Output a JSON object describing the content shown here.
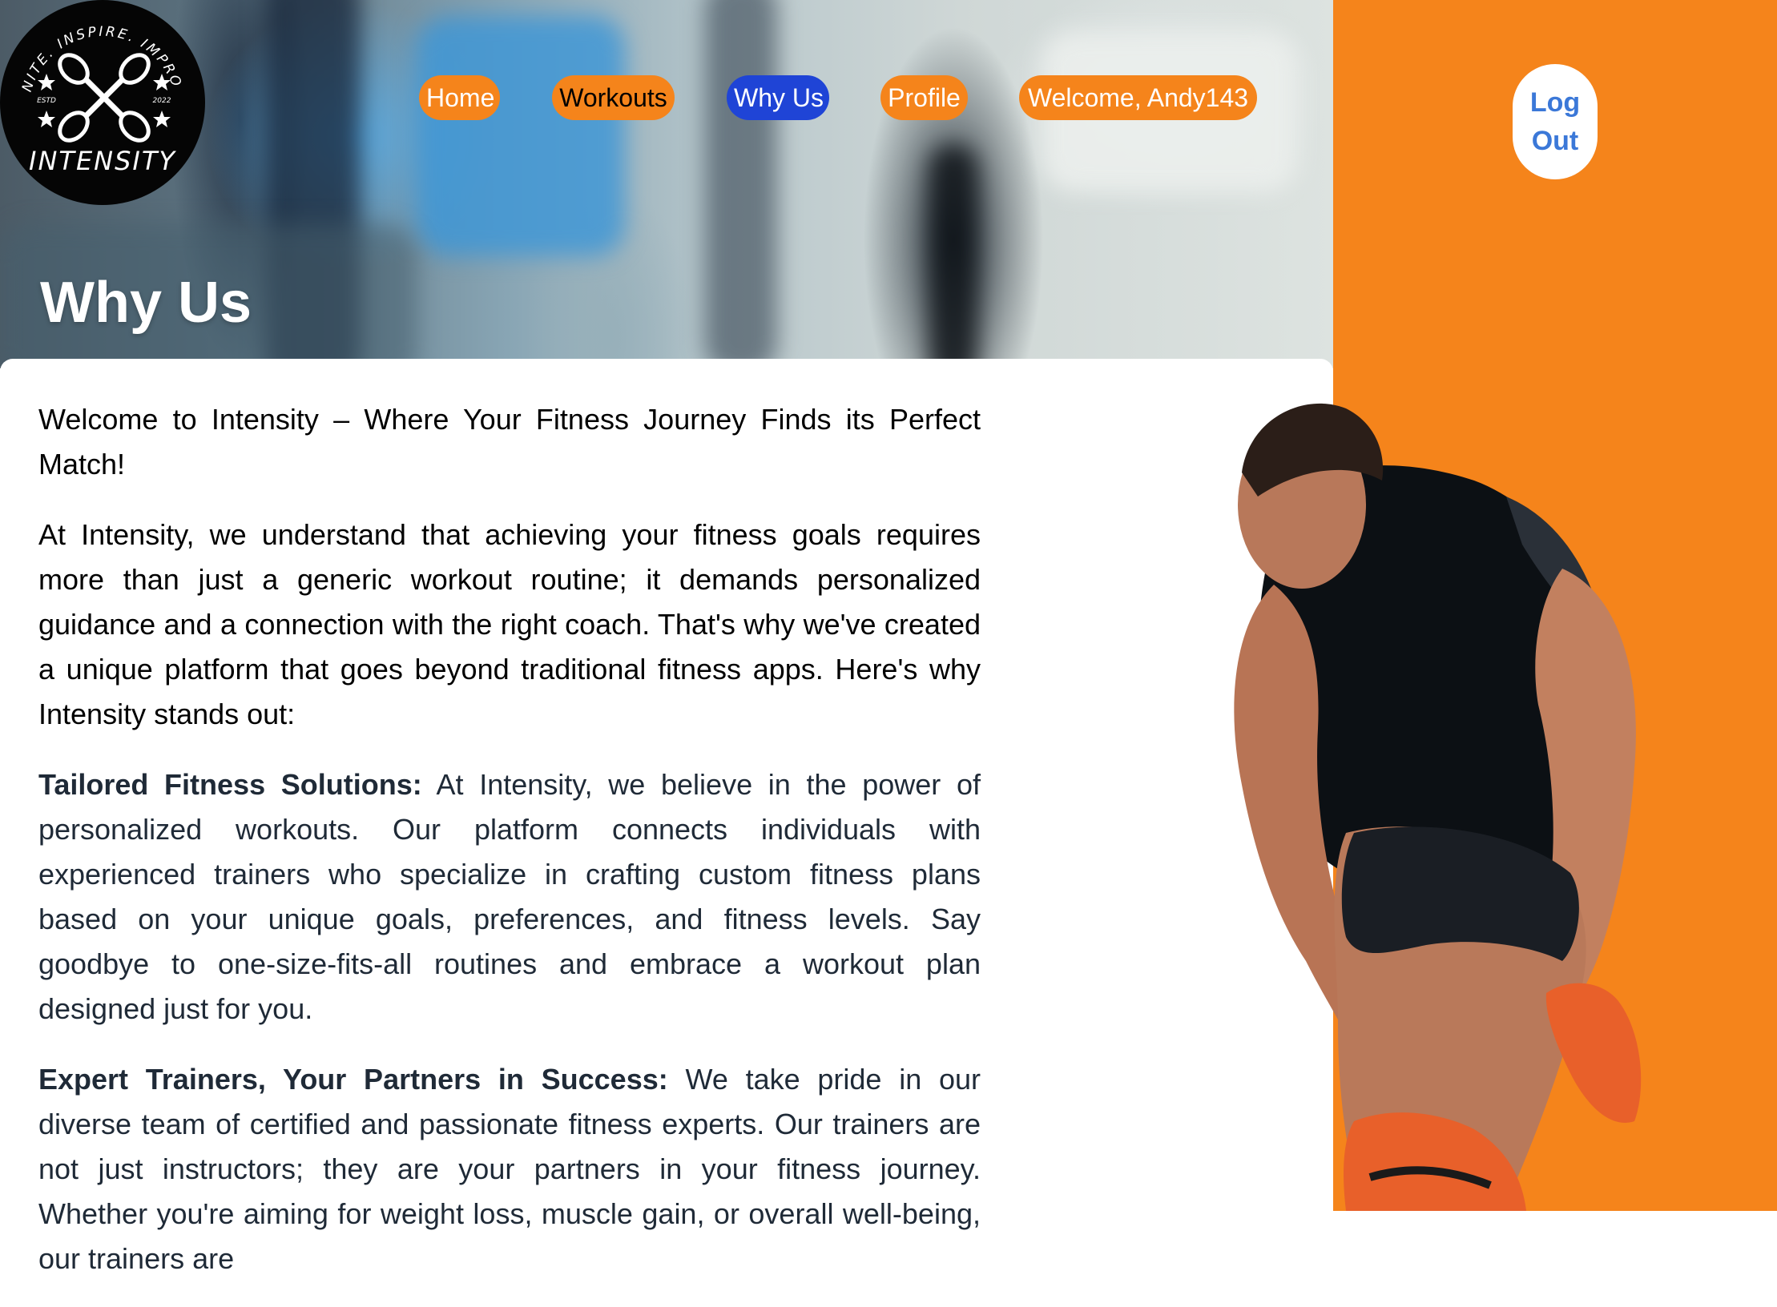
{
  "logo": {
    "name": "INTENSITY",
    "tagline": "IGNITE. INSPIRE. IMPROVE",
    "estd_left": "ESTD",
    "estd_right": "2022"
  },
  "nav": {
    "home": "Home",
    "workouts": "Workouts",
    "why_us": "Why Us",
    "profile": "Profile",
    "welcome": "Welcome, Andy143"
  },
  "logout": {
    "line1": "Log",
    "line2": "Out"
  },
  "page_title": "Why Us",
  "content": {
    "intro": "Welcome to Intensity – Where Your Fitness Journey Finds its Perfect Match!",
    "p2": "At Intensity, we understand that achieving your fitness goals requires more than just a generic workout routine; it demands personalized guidance and a connection with the right coach. That's why we've created a unique platform that goes beyond traditional fitness apps. Here's why Intensity stands out:",
    "section1_heading": "Tailored Fitness Solutions:",
    "section1_text": "At Intensity, we believe in the power of personalized workouts. Our platform connects individuals with experienced trainers who specialize in crafting custom fitness plans based on your unique goals, preferences, and fitness levels. Say goodbye to one-size-fits-all routines and embrace a workout plan designed just for you.",
    "section2_heading": "Expert Trainers, Your Partners in Success:",
    "section2_text": "We take pride in our diverse team of certified and passionate fitness experts. Our trainers are not just instructors; they are your partners in your fitness journey. Whether you're aiming for weight loss, muscle gain, or overall well-being, our trainers are"
  },
  "colors": {
    "accent_orange": "#f5841b",
    "active_nav_blue": "#1f44d6",
    "logout_text_blue": "#3b78d8",
    "body_text": "#1f2a37"
  }
}
